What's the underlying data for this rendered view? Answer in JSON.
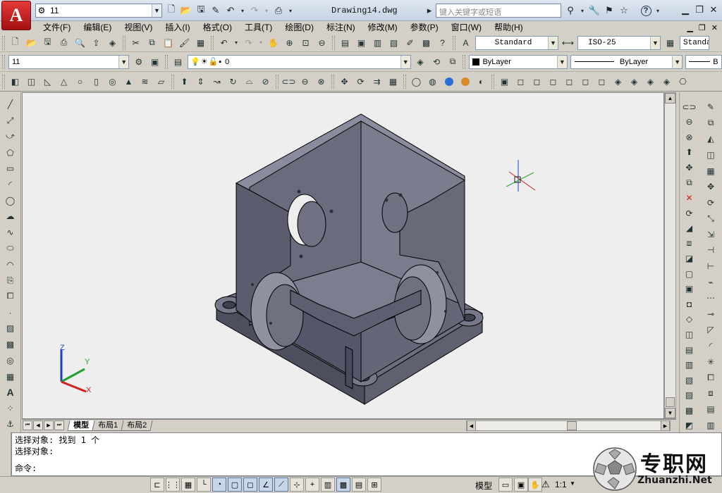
{
  "titlebar": {
    "app_letter": "A",
    "workspace": "11",
    "document_title": "Drawing14.dwg",
    "search_placeholder": "键入关键字或短语",
    "help_label": "?"
  },
  "menu": [
    "文件(F)",
    "编辑(E)",
    "视图(V)",
    "插入(I)",
    "格式(O)",
    "工具(T)",
    "绘图(D)",
    "标注(N)",
    "修改(M)",
    "参数(P)",
    "窗口(W)",
    "帮助(H)"
  ],
  "styles": {
    "text_style": "Standard",
    "dim_style": "ISO-25",
    "table_style": "Standa"
  },
  "layers": {
    "workspace_combo": "11",
    "current_layer": "0",
    "color": "ByLayer",
    "linetype": "ByLayer",
    "lineweight": "B"
  },
  "layout_tabs": [
    {
      "label": "模型",
      "active": true
    },
    {
      "label": "布局1",
      "active": false
    },
    {
      "label": "布局2",
      "active": false
    }
  ],
  "command": {
    "history": [
      "选择对象: 找到 1 个",
      "选择对象:"
    ],
    "prompt": "命令:"
  },
  "status": {
    "model_label": "模型",
    "scale": "1:1"
  },
  "ucs": {
    "x": "X",
    "y": "Y",
    "z": "Z"
  },
  "watermark": {
    "brand": "专职网",
    "url": "Zhuanzhi.Net"
  },
  "colors": {
    "model_body": "#5a5b6b",
    "model_inner": "#7d7e8e",
    "viewport_bg": "#eeeeee",
    "axis_x": "#d02020",
    "axis_y": "#20a030",
    "axis_z": "#2040c0"
  }
}
